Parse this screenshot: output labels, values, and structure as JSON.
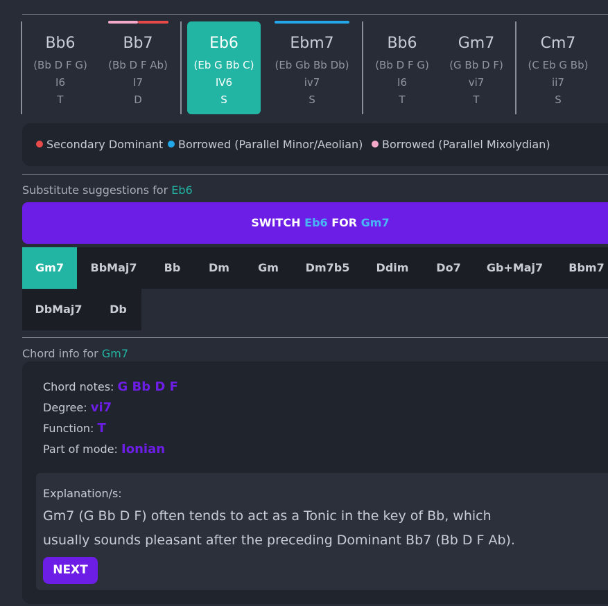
{
  "progression": [
    {
      "name": "Bb6",
      "notes": "(Bb D F G)",
      "degree": "I6",
      "function": "T"
    },
    {
      "name": "Bb7",
      "notes": "(Bb D F Ab)",
      "degree": "I7",
      "function": "D",
      "marks": [
        "#f5a9c8",
        "#e84a4a"
      ]
    },
    {
      "name": "Eb6",
      "notes": "(Eb G Bb C)",
      "degree": "IV6",
      "function": "S",
      "active": true
    },
    {
      "name": "Ebm7",
      "notes": "(Eb Gb Bb Db)",
      "degree": "iv7",
      "function": "S",
      "marks": [
        "#22a7e8"
      ]
    },
    {
      "name": "Bb6",
      "notes": "(Bb D F G)",
      "degree": "I6",
      "function": "T"
    },
    {
      "name": "Gm7",
      "notes": "(G Bb D F)",
      "degree": "vi7",
      "function": "T"
    },
    {
      "name": "Cm7",
      "notes": "(C Eb G Bb)",
      "degree": "ii7",
      "function": "S"
    }
  ],
  "legend": [
    {
      "label": "Secondary Dominant",
      "color": "#e84a4a"
    },
    {
      "label": "Borrowed (Parallel Minor/Aeolian)",
      "color": "#22a7e8"
    },
    {
      "label": "Borrowed (Parallel Mixolydian)",
      "color": "#f5a9c8"
    }
  ],
  "substitute": {
    "label": "Substitute suggestions for",
    "chord": "Eb6",
    "switch": {
      "prefix": "SWITCH",
      "from": "Eb6",
      "mid": "FOR",
      "to": "Gm7"
    },
    "options": [
      "Gm7",
      "BbMaj7",
      "Bb",
      "Dm",
      "Gm",
      "Dm7b5",
      "Ddim",
      "Do7",
      "Gb+Maj7",
      "Bbm7",
      "DbMaj7",
      "Db"
    ],
    "selected": "Gm7"
  },
  "chord_info": {
    "label": "Chord info for",
    "chord": "Gm7",
    "notes_label": "Chord notes:",
    "notes": "G Bb D F",
    "degree_label": "Degree:",
    "degree": "vi7",
    "function_label": "Function:",
    "function": "T",
    "mode_label": "Part of mode:",
    "mode": "Ionian",
    "explanation_title": "Explanation/s:",
    "explanation": "Gm7 (G Bb D F) often tends to act as a Tonic in the key of Bb, which usually sounds pleasant after the preceding Dominant Bb7 (Bb D F Ab).",
    "next_label": "NEXT"
  },
  "colors": {
    "accent": "#23b5a3",
    "purple": "#6d1ee6",
    "background": "#282c37"
  }
}
